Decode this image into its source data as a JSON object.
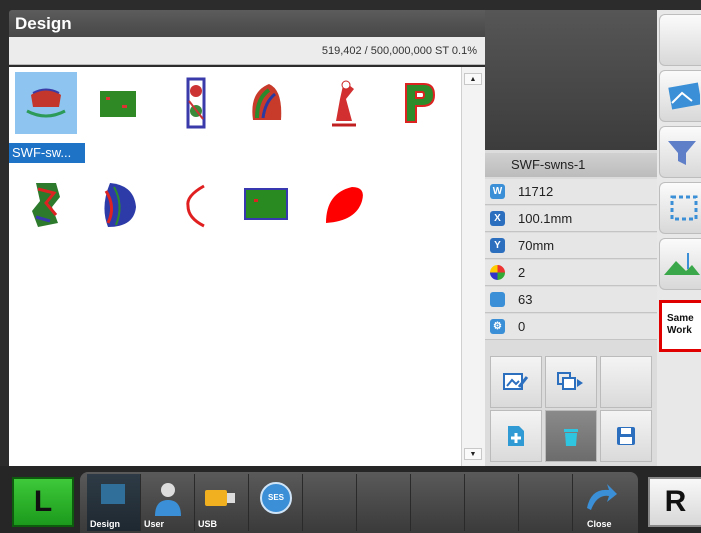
{
  "window": {
    "title": "Design"
  },
  "stitch_info": {
    "text": "519,402 / 500,000,000 ST  0.1%"
  },
  "scroll": {
    "up": "▲",
    "down": "▼"
  },
  "designs": {
    "selected_label": "SWF-sw...",
    "items": [
      {
        "icon": "swf-logo-design"
      },
      {
        "icon": "green-patch-design"
      },
      {
        "icon": "vertical-badge-design"
      },
      {
        "icon": "headdress-design"
      },
      {
        "icon": "baseball-player-design"
      },
      {
        "icon": "letter-p-design"
      },
      {
        "icon": "multicolor-emblem-design"
      },
      {
        "icon": "blue-shape-design"
      },
      {
        "icon": "red-arc-design"
      },
      {
        "icon": "green-rectangle-design"
      },
      {
        "icon": "red-leaf-design"
      }
    ]
  },
  "details": {
    "design_name": "SWF-swns-1",
    "stitches": "11712",
    "width": "100.1mm",
    "height": "70mm",
    "colors": "2",
    "color_changes": "63",
    "trims": "0",
    "icons": {
      "stitches": "W",
      "width": "X",
      "height": "Y",
      "trims": "⚙"
    }
  },
  "right_panel": {
    "same_work_label": "Same Work"
  },
  "bottom": {
    "left_button": "L",
    "right_button": "R",
    "tabs": {
      "design": "Design",
      "user": "User",
      "usb": "USB",
      "ses": "SES",
      "close": "Close"
    }
  },
  "colors": {
    "selection": "#8ec4f0",
    "name_highlight": "#1e73c7",
    "same_work_border": "#e00000",
    "L_button": "#2fb52c"
  }
}
